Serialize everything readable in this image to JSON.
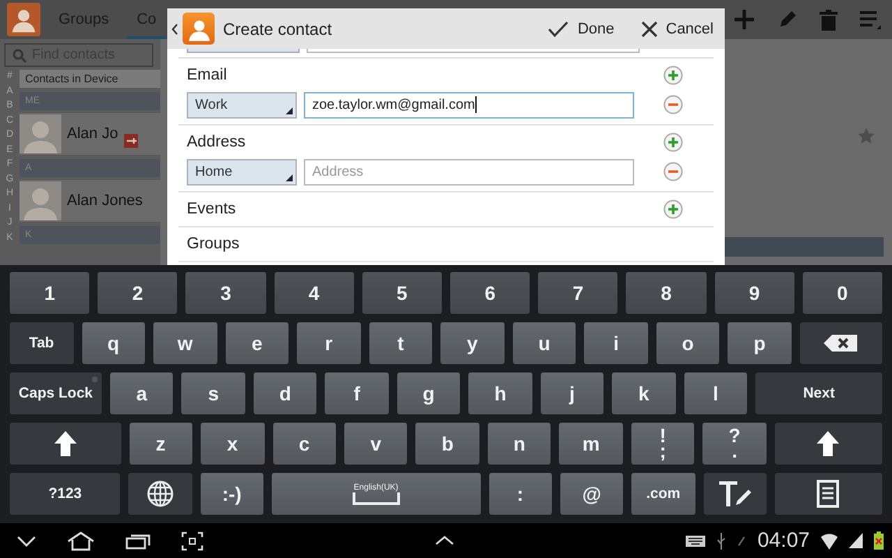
{
  "app": {
    "tabs": [
      {
        "label": "Groups",
        "selected": false
      },
      {
        "label": "Co",
        "selected": true
      }
    ],
    "search": {
      "placeholder": "Find contacts"
    },
    "index": [
      "#",
      "A",
      "B",
      "C",
      "D",
      "E",
      "F",
      "G",
      "H",
      "I",
      "J",
      "K"
    ],
    "list_title": "Contacts in Device",
    "list": [
      {
        "kind": "header",
        "label": "ME"
      },
      {
        "kind": "contact",
        "name": "Alan Jo",
        "badge": true
      },
      {
        "kind": "header",
        "label": "A"
      },
      {
        "kind": "contact",
        "name": "Alan Jones",
        "badge": false
      },
      {
        "kind": "header",
        "label": "K"
      }
    ]
  },
  "dialog": {
    "title": "Create contact",
    "actions": [
      {
        "kind": "done",
        "label": "Done"
      },
      {
        "kind": "cancel",
        "label": "Cancel"
      }
    ],
    "sections": [
      {
        "label": "Email",
        "addable": true,
        "fields": [
          {
            "type": "Work",
            "value": "zoe.taylor.wm@gmail.com",
            "focused": true
          }
        ]
      },
      {
        "label": "Address",
        "addable": true,
        "fields": [
          {
            "type": "Home",
            "placeholder": "Address",
            "focused": false
          }
        ]
      },
      {
        "label": "Events",
        "addable": true
      },
      {
        "label": "Groups",
        "addable": false
      }
    ]
  },
  "keyboard": {
    "rows": [
      {
        "keys": [
          {
            "kind": "num",
            "label": "1"
          },
          {
            "kind": "num",
            "label": "2"
          },
          {
            "kind": "num",
            "label": "3"
          },
          {
            "kind": "num",
            "label": "4"
          },
          {
            "kind": "num",
            "label": "5"
          },
          {
            "kind": "num",
            "label": "6"
          },
          {
            "kind": "num",
            "label": "7"
          },
          {
            "kind": "num",
            "label": "8"
          },
          {
            "kind": "num",
            "label": "9"
          },
          {
            "kind": "num",
            "label": "0"
          }
        ]
      },
      {
        "keys": [
          {
            "kind": "tab",
            "label": "Tab"
          },
          {
            "kind": "char",
            "label": "q"
          },
          {
            "kind": "char",
            "label": "w"
          },
          {
            "kind": "char",
            "label": "e"
          },
          {
            "kind": "char",
            "label": "r"
          },
          {
            "kind": "char",
            "label": "t"
          },
          {
            "kind": "char",
            "label": "y"
          },
          {
            "kind": "char",
            "label": "u"
          },
          {
            "kind": "char",
            "label": "i"
          },
          {
            "kind": "char",
            "label": "o"
          },
          {
            "kind": "char",
            "label": "p"
          },
          {
            "kind": "backspace"
          }
        ]
      },
      {
        "keys": [
          {
            "kind": "caps",
            "label": "Caps Lock",
            "on": false
          },
          {
            "kind": "char",
            "label": "a"
          },
          {
            "kind": "char",
            "label": "s"
          },
          {
            "kind": "char",
            "label": "d"
          },
          {
            "kind": "char",
            "label": "f"
          },
          {
            "kind": "char",
            "label": "g"
          },
          {
            "kind": "char",
            "label": "h"
          },
          {
            "kind": "char",
            "label": "j"
          },
          {
            "kind": "char",
            "label": "k"
          },
          {
            "kind": "char",
            "label": "l"
          },
          {
            "kind": "next",
            "label": "Next"
          }
        ]
      },
      {
        "keys": [
          {
            "kind": "shift"
          },
          {
            "kind": "char",
            "label": "z"
          },
          {
            "kind": "char",
            "label": "x"
          },
          {
            "kind": "char",
            "label": "c"
          },
          {
            "kind": "char",
            "label": "v"
          },
          {
            "kind": "char",
            "label": "b"
          },
          {
            "kind": "char",
            "label": "n"
          },
          {
            "kind": "char",
            "label": "m"
          },
          {
            "kind": "char",
            "label": "!",
            "sub": ";"
          },
          {
            "kind": "char",
            "label": "?",
            "sub": "."
          },
          {
            "kind": "shift2"
          }
        ]
      },
      {
        "keys": [
          {
            "kind": "symbols",
            "label": "?123"
          },
          {
            "kind": "globe"
          },
          {
            "kind": "char",
            "label": ":-)"
          },
          {
            "kind": "space",
            "label": "English(UK)"
          },
          {
            "kind": "char",
            "label": ":"
          },
          {
            "kind": "char",
            "label": "@"
          },
          {
            "kind": "small",
            "label": ".com"
          },
          {
            "kind": "handwriting"
          },
          {
            "kind": "clipboard"
          }
        ]
      }
    ]
  },
  "status_bar": {
    "time": "04:07"
  }
}
